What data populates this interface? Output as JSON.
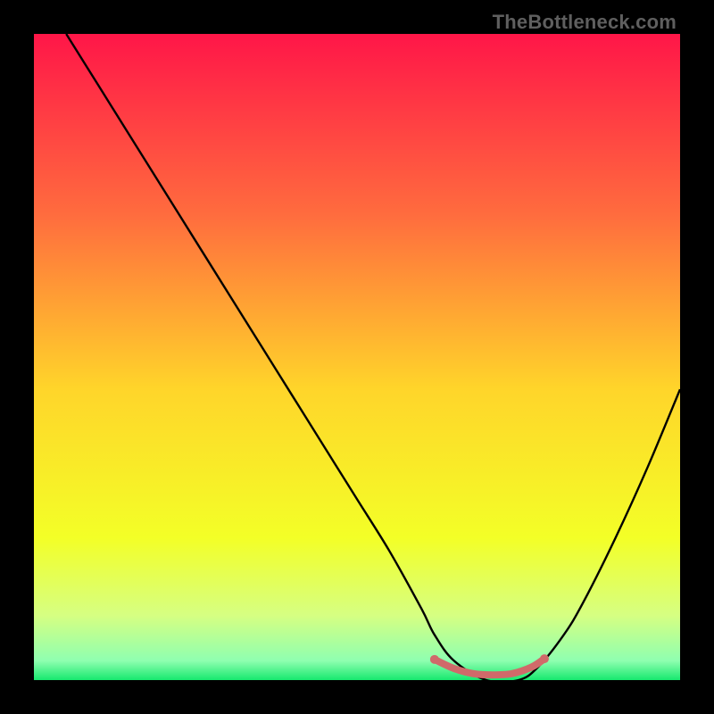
{
  "watermark": "TheBottleneck.com",
  "chart_data": {
    "type": "line",
    "title": "",
    "xlabel": "",
    "ylabel": "",
    "x_range": [
      0,
      100
    ],
    "y_range": [
      0,
      100
    ],
    "background_gradient_stops": [
      {
        "pct": 0,
        "color": "#ff1648"
      },
      {
        "pct": 28,
        "color": "#ff6c3e"
      },
      {
        "pct": 55,
        "color": "#ffd52a"
      },
      {
        "pct": 78,
        "color": "#f3ff27"
      },
      {
        "pct": 90,
        "color": "#d6ff82"
      },
      {
        "pct": 97,
        "color": "#8fffb0"
      },
      {
        "pct": 100,
        "color": "#17e86e"
      }
    ],
    "series": [
      {
        "name": "bottleneck-curve",
        "color": "#000000",
        "x": [
          5,
          10,
          15,
          20,
          25,
          30,
          35,
          40,
          45,
          50,
          55,
          60,
          62,
          65,
          70,
          75,
          78,
          82,
          85,
          90,
          95,
          100
        ],
        "y": [
          100,
          92,
          84,
          76,
          68,
          60,
          52,
          44,
          36,
          28,
          20,
          11,
          7,
          3,
          0,
          0,
          2,
          7,
          12,
          22,
          33,
          45
        ]
      }
    ],
    "highlight": {
      "name": "optimal-range",
      "color": "#d06a6a",
      "x": [
        62,
        65,
        68,
        71,
        74,
        77,
        79
      ],
      "y": [
        3.2,
        1.8,
        1.0,
        0.8,
        1.0,
        2.0,
        3.3
      ],
      "endpoints_radius": 5,
      "mid_radius": 3.4
    }
  }
}
